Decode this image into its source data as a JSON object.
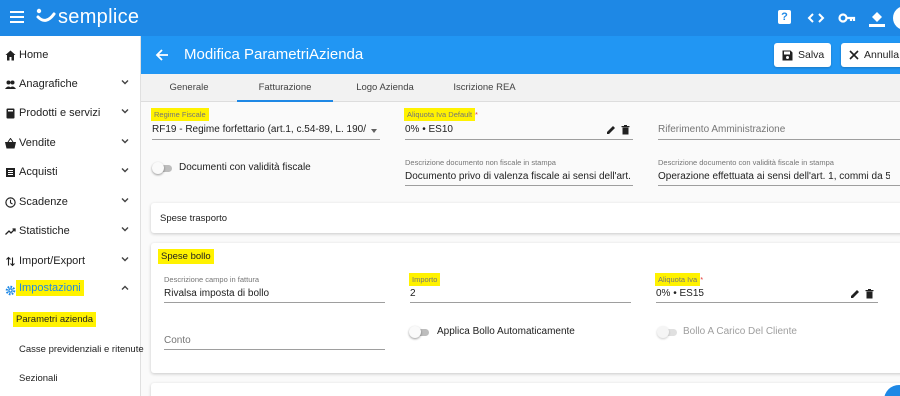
{
  "app": {
    "name": "semplice"
  },
  "topbar_icons": [
    "menu-icon",
    "help-icon",
    "code-icon",
    "key-icon",
    "paint-bucket-icon"
  ],
  "help_glyph": "?",
  "sidebar": {
    "items": [
      {
        "label": "Home",
        "icon": "home-icon"
      },
      {
        "label": "Anagrafiche",
        "icon": "people-icon"
      },
      {
        "label": "Prodotti e servizi",
        "icon": "book-icon"
      },
      {
        "label": "Vendite",
        "icon": "basket-icon"
      },
      {
        "label": "Acquisti",
        "icon": "receipt-icon"
      },
      {
        "label": "Scadenze",
        "icon": "clock-icon"
      },
      {
        "label": "Statistiche",
        "icon": "trending-icon"
      },
      {
        "label": "Import/Export",
        "icon": "import-export-icon"
      },
      {
        "label": "Impostazioni",
        "icon": "gear-icon"
      }
    ],
    "subitems": [
      {
        "label": "Parametri azienda"
      },
      {
        "label": "Casse previdenziali e ritenute"
      },
      {
        "label": "Sezionali"
      }
    ]
  },
  "header": {
    "title": "Modifica ParametriAzienda",
    "save_label": "Salva",
    "cancel_label": "Annulla"
  },
  "tabs": [
    {
      "label": "Generale"
    },
    {
      "label": "Fatturazione"
    },
    {
      "label": "Logo Azienda"
    },
    {
      "label": "Iscrizione REA"
    }
  ],
  "form": {
    "regime_label": "Regime Fiscale",
    "regime_value": "RF19 - Regime forfettario (art.1, c.54-89, L. 190/...",
    "aliquota_default_label": "Aliquota Iva Default",
    "aliquota_default_value": "0% • ES10",
    "riferimento_placeholder": "Riferimento Amministrazione",
    "documenti_toggle_label": "Documenti con validità fiscale",
    "desc_non_fiscale_label": "Descrizione documento non fiscale in stampa",
    "desc_non_fiscale_value": "Documento privo di valenza fiscale ai sensi dell'art. 2",
    "desc_fiscale_label": "Descrizione documento con validità fiscale in stampa",
    "desc_fiscale_value": "Operazione effettuata ai sensi dell'art. 1, commi da 5",
    "required_mark": "*"
  },
  "spese_trasporto": {
    "title": "Spese trasporto"
  },
  "spese_bollo": {
    "title": "Spese bollo",
    "desc_campo_label": "Descrizione campo in fattura",
    "desc_campo_value": "Rivalsa imposta di bollo",
    "importo_label": "Importo",
    "importo_value": "2",
    "aliquota_label": "Aliquota Iva",
    "aliquota_value": "0% • ES15",
    "conto_placeholder": "Conto",
    "applica_bollo_label": "Applica Bollo Automaticamente",
    "bollo_carico_label": "Bollo A Carico Del Cliente"
  },
  "colors": {
    "primary": "#1e88e5",
    "header": "#2196f3",
    "highlight": "#fff200"
  }
}
